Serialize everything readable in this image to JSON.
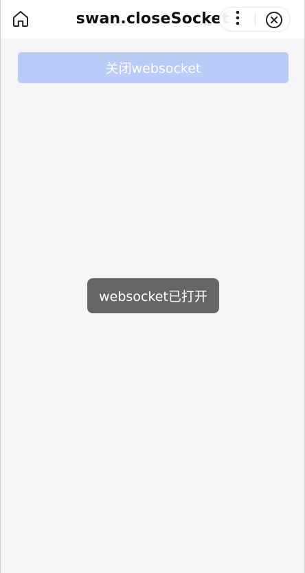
{
  "nav": {
    "title": "swan.closeSocket",
    "home_icon": "home-icon",
    "more_icon": "more-vertical-icon",
    "close_icon": "close-circle-icon"
  },
  "main": {
    "close_websocket_label": "关闭websocket",
    "button_color": "#b8ccf7"
  },
  "toast": {
    "text": "websocket已打开"
  },
  "colors": {
    "background": "#f5f4f7",
    "nav_background": "#ffffff",
    "toast_background": "#5a5a5c"
  }
}
